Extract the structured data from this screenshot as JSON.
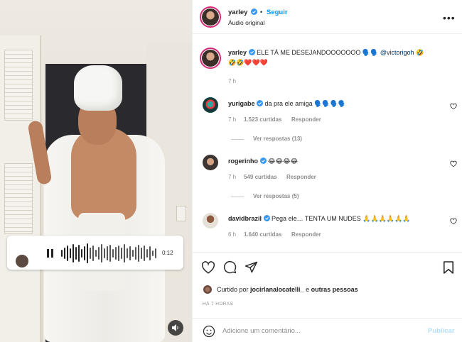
{
  "post": {
    "author": "yarley",
    "follow_label": "Seguir",
    "separator": "•",
    "audio_label": "Áudio original",
    "more_label": "•••",
    "caption_line1": "ELE TÁ ME DESEJANDOOOOOOO 🗣️🗣️ ",
    "caption_mention": "@victorigoh",
    "caption_tail": " 🤣",
    "caption_line2": "🤣🤣❤️❤️❤️",
    "caption_time": "7 h"
  },
  "media": {
    "audio_time": "0:12"
  },
  "comments": [
    {
      "user": "yurigabe",
      "text": "da pra ele amiga 🗣️🗣️🗣️🗣️",
      "time": "7 h",
      "likes": "1.523 curtidas",
      "reply": "Responder",
      "view_replies": "Ver respostas (13)"
    },
    {
      "user": "rogerinho",
      "text": "😂😂😂😂",
      "time": "7 h",
      "likes": "549 curtidas",
      "reply": "Responder",
      "view_replies": "Ver respostas (5)"
    },
    {
      "user": "davidbrazil",
      "text": "Pega ele… TENTA UM NUDES 🙏🙏🙏🙏🙏🙏",
      "time": "6 h",
      "likes": "1.640 curtidas",
      "reply": "Responder"
    }
  ],
  "likes": {
    "prefix": "Curtido por ",
    "user": "jocirlanalocatelli_",
    "middle": " e ",
    "others": "outras pessoas"
  },
  "post_time": "HÁ 7 HORAS",
  "comment_form": {
    "placeholder": "Adicione um comentário...",
    "publish_label": "Publicar"
  },
  "colors": {
    "accent": "#0095f6",
    "verified": "#3897f0",
    "publish_disabled": "#b2dffc"
  },
  "icons": [
    "heart-icon",
    "comment-icon",
    "share-icon",
    "bookmark-icon",
    "emoji-icon",
    "volume-icon",
    "pause-icon",
    "verified-icon",
    "more-icon"
  ]
}
